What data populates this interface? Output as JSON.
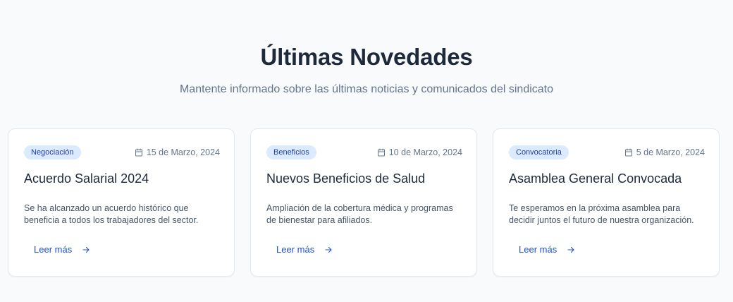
{
  "section": {
    "title": "Últimas Novedades",
    "subtitle": "Mantente informado sobre las últimas noticias y comunicados del sindicato"
  },
  "cards": [
    {
      "badge": "Negociación",
      "date": "15 de Marzo, 2024",
      "title": "Acuerdo Salarial 2024",
      "description": "Se ha alcanzado un acuerdo histórico que beneficia a todos los trabajadores del sector.",
      "link_label": "Leer más"
    },
    {
      "badge": "Beneficios",
      "date": "10 de Marzo, 2024",
      "title": "Nuevos Beneficios de Salud",
      "description": "Ampliación de la cobertura médica y programas de bienestar para afiliados.",
      "link_label": "Leer más"
    },
    {
      "badge": "Convocatoria",
      "date": "5 de Marzo, 2024",
      "title": "Asamblea General Convocada",
      "description": "Te esperamos en la próxima asamblea para decidir juntos el futuro de nuestra organización.",
      "link_label": "Leer más"
    }
  ],
  "icons": {
    "date": "calendar-icon",
    "link": "arrow-right-icon"
  },
  "colors": {
    "background": "#f8fafc",
    "badge_bg": "#dbeafe",
    "badge_text": "#1e40af",
    "link": "#1d4ed8"
  }
}
